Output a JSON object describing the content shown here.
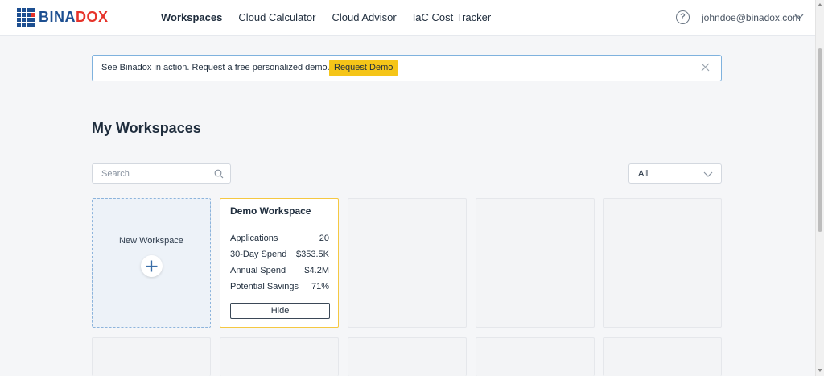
{
  "header": {
    "logo_text_primary": "BINA",
    "logo_text_accent": "DOX",
    "nav": [
      {
        "label": "Workspaces",
        "active": true
      },
      {
        "label": "Cloud Calculator",
        "active": false
      },
      {
        "label": "Cloud Advisor",
        "active": false
      },
      {
        "label": "IaC Cost Tracker",
        "active": false
      }
    ],
    "help_glyph": "?",
    "user_email": "johndoe@binadox.com"
  },
  "banner": {
    "text": "See Binadox in action. Request a free personalized demo.",
    "button_label": "Request Demo"
  },
  "main": {
    "title": "My Workspaces",
    "search_placeholder": "Search",
    "filter_value": "All",
    "new_workspace_label": "New Workspace",
    "demo_card": {
      "title": "Demo Workspace",
      "stats": [
        {
          "label": "Applications",
          "value": "20"
        },
        {
          "label": "30-Day Spend",
          "value": "$353.5K"
        },
        {
          "label": "Annual Spend",
          "value": "$4.2M"
        },
        {
          "label": "Potential Savings",
          "value": "71%"
        }
      ],
      "hide_label": "Hide"
    }
  },
  "colors": {
    "brand_blue": "#1d4f91",
    "brand_red": "#e6332a",
    "accent_yellow": "#f5c518",
    "banner_border": "#7fb2de"
  },
  "icons": [
    "logo-grid-icon",
    "help-icon",
    "chevron-down-icon",
    "close-icon",
    "search-icon",
    "plus-icon"
  ]
}
